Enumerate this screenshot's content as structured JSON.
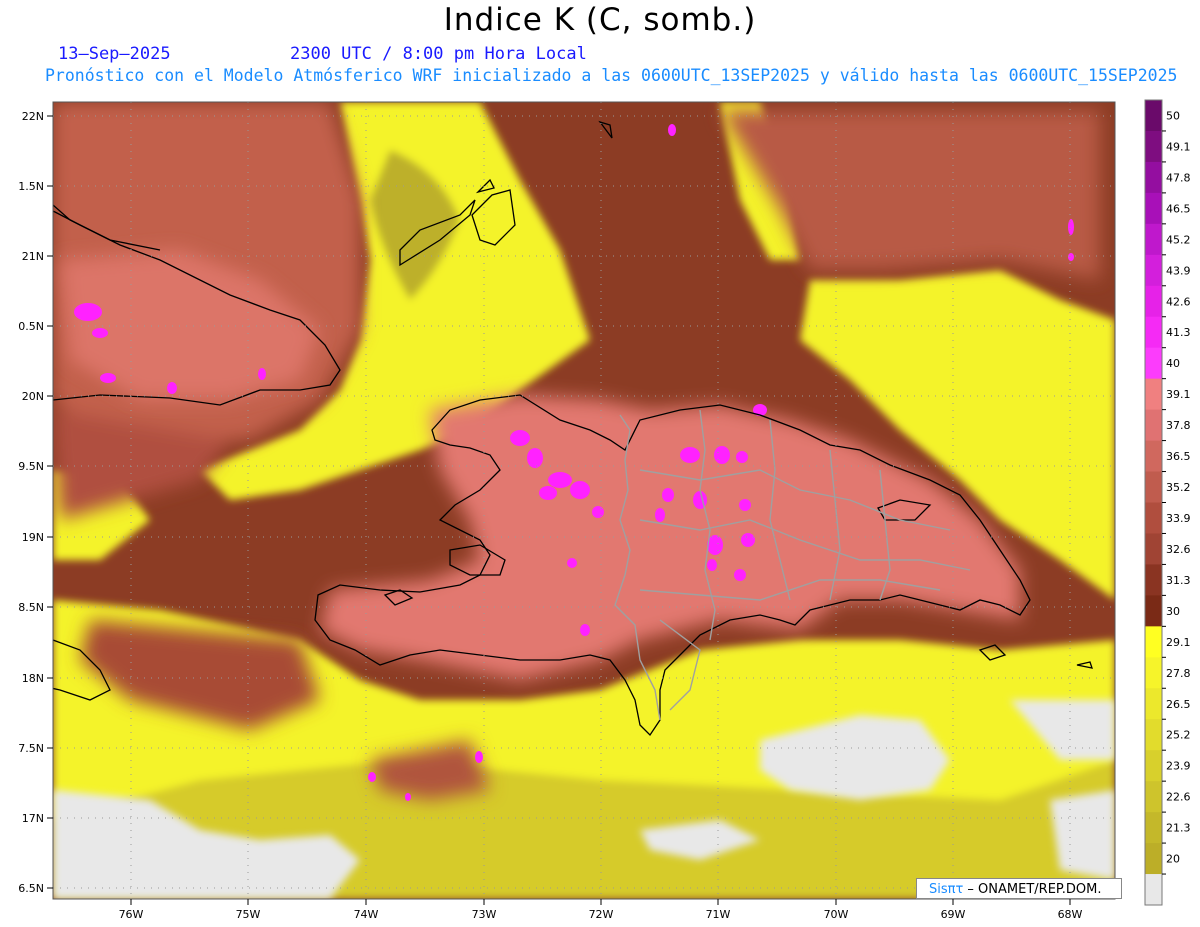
{
  "title": "Indice K (C, somb.)",
  "date": "13–Sep–2025",
  "time": "2300 UTC / 8:00 pm Hora Local",
  "description": "Pronóstico con el Modelo Atmósferico WRF inicializado a las 0600UTC_13SEP2025 y válido hasta las  0600UTC_15SEP2025",
  "credit": {
    "brand": "Sisπτ",
    "org": " – ONAMET/REP.DOM."
  },
  "lat_labels": [
    "22N",
    "1.5N",
    "21N",
    "0.5N",
    "20N",
    "9.5N",
    "19N",
    "8.5N",
    "18N",
    "7.5N",
    "17N",
    "6.5N"
  ],
  "lon_labels": [
    "76W",
    "75W",
    "74W",
    "73W",
    "72W",
    "71W",
    "70W",
    "69W",
    "68W"
  ],
  "colorbar": {
    "labels": [
      "50",
      "49.1",
      "47.8",
      "46.5",
      "45.2",
      "43.9",
      "42.6",
      "41.3",
      "40",
      "39.1",
      "37.8",
      "36.5",
      "35.2",
      "33.9",
      "32.6",
      "31.3",
      "30",
      "29.1",
      "27.8",
      "26.5",
      "25.2",
      "23.9",
      "22.6",
      "21.3",
      "20"
    ],
    "colors": [
      "#6a0a6a",
      "#7e0d80",
      "#940ea0",
      "#a810b8",
      "#bf18cc",
      "#d31fdc",
      "#e622e8",
      "#f52af5",
      "#fc3cfc",
      "#f08080",
      "#e07272",
      "#d0685e",
      "#c05c4e",
      "#b04e3e",
      "#a04434",
      "#8a3422",
      "#7a2a16",
      "#ffff22",
      "#f6f42a",
      "#ece82c",
      "#e2dc2c",
      "#d8d02c",
      "#cec42c",
      "#c4b82a",
      "#bcae28",
      "#e8e8e8"
    ]
  },
  "colors": {
    "ocean_high": "#8b3a22",
    "land_high": "#e07870",
    "mid": "#c4604e",
    "low": "#f4f430",
    "very_low": "#e8e8e8",
    "extreme": "#ff22ff",
    "coast": "#000000",
    "province_border": "#a0a0a0"
  }
}
